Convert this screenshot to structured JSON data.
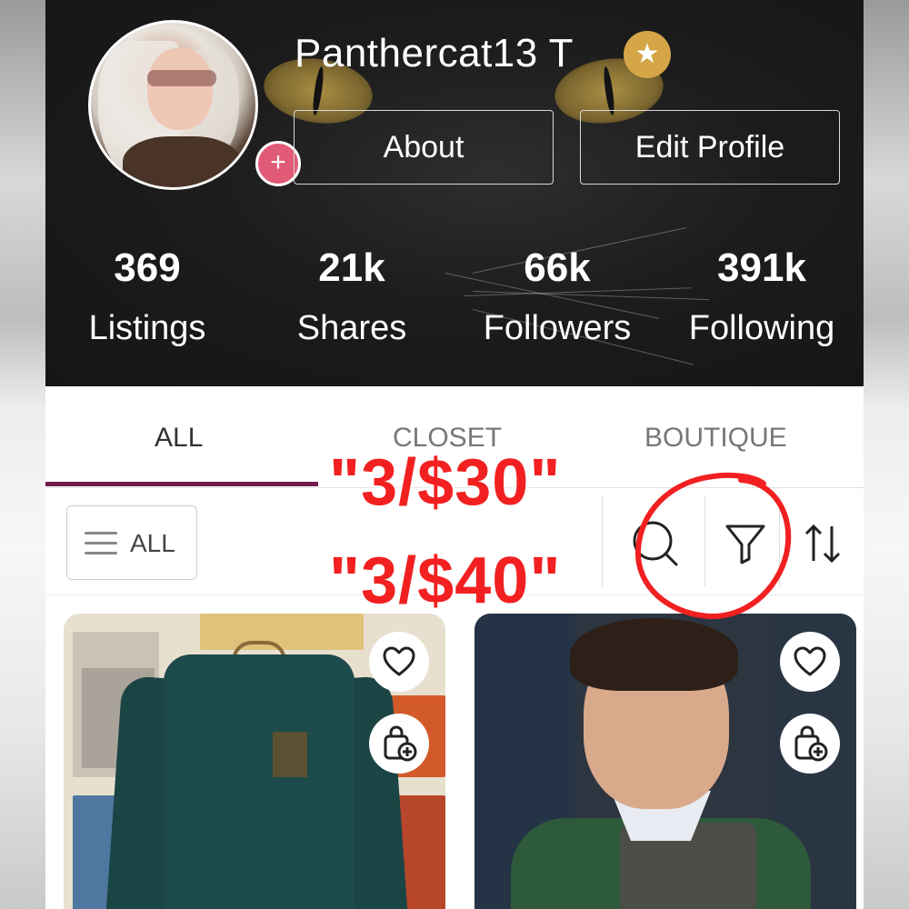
{
  "profile": {
    "username": "Panthercat13 T",
    "add_icon": "+",
    "star_icon": "★",
    "about_label": "About",
    "edit_label": "Edit Profile"
  },
  "stats": [
    {
      "value": "369",
      "label": "Listings"
    },
    {
      "value": "21k",
      "label": "Shares"
    },
    {
      "value": "66k",
      "label": "Followers"
    },
    {
      "value": "391k",
      "label": "Following"
    }
  ],
  "tabs": [
    {
      "label": "ALL",
      "active": true
    },
    {
      "label": "CLOSET",
      "active": false
    },
    {
      "label": "BOUTIQUE",
      "active": false
    }
  ],
  "filter": {
    "all_label": "ALL",
    "icons": [
      "search-icon",
      "filter-icon",
      "sort-icon"
    ]
  },
  "listings": [
    {
      "icons": [
        "heart-icon",
        "bag-add-icon"
      ]
    },
    {
      "icons": [
        "heart-icon",
        "bag-add-icon"
      ]
    }
  ],
  "annotations": [
    "\"3/$30\"",
    "\"3/$40\""
  ],
  "colors": {
    "accent": "#731e4e",
    "add_badge": "#e15a77",
    "star_badge": "#d4a648",
    "annotation": "#f22020"
  }
}
